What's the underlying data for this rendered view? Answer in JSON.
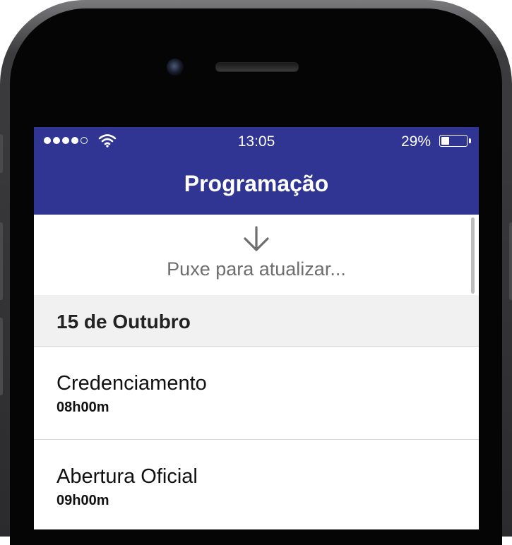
{
  "status_bar": {
    "signal_filled": 4,
    "signal_total": 5,
    "time": "13:05",
    "battery_percent": "29%",
    "battery_level": 0.29
  },
  "navbar": {
    "title": "Programação",
    "color": "#303593"
  },
  "pull_to_refresh": {
    "icon": "arrow-down-icon",
    "text": "Puxe para atualizar..."
  },
  "schedule": {
    "section_date": "15 de Outubro",
    "items": [
      {
        "title": "Credenciamento",
        "time": "08h00m"
      },
      {
        "title": "Abertura Oficial",
        "time": "09h00m"
      }
    ]
  }
}
